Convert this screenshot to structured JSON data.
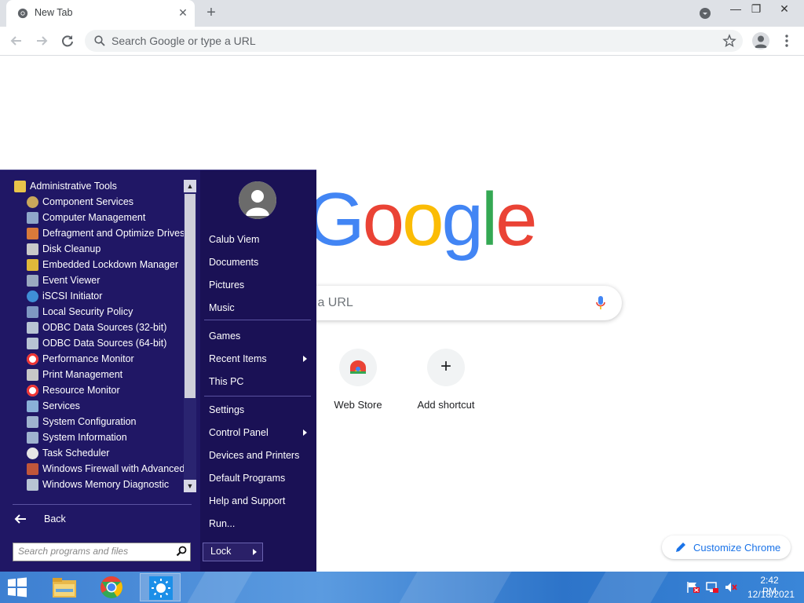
{
  "browser": {
    "tab_title": "New Tab",
    "new_tab_symbol": "+",
    "close_symbol": "✕",
    "omnibox_placeholder": "Search Google or type a URL",
    "window_min": "—",
    "window_restore": "❐",
    "window_close": "✕"
  },
  "ntp": {
    "logo_letters": [
      "G",
      "o",
      "o",
      "g",
      "l",
      "e"
    ],
    "logo_colors": [
      "#4285f4",
      "#ea4335",
      "#fbbc05",
      "#4285f4",
      "#34a853",
      "#ea4335"
    ],
    "search_placeholder": "Search Google or type a URL",
    "search_visible_text": "r type a URL",
    "shortcuts": [
      {
        "label": "Web Store",
        "icon": "chrome-web-store-icon"
      },
      {
        "label": "Add shortcut",
        "icon": "plus-icon",
        "symbol": "+"
      }
    ],
    "customize_label": "Customize Chrome"
  },
  "start_menu": {
    "programs": [
      {
        "label": "Administrative Tools",
        "icon": "folder-icon",
        "color": "#e8c44a",
        "indent": 0
      },
      {
        "label": "Component Services",
        "icon": "component-services-icon",
        "color": "#c9a75b",
        "indent": 1
      },
      {
        "label": "Computer Management",
        "icon": "computer-management-icon",
        "color": "#8fa7c9",
        "indent": 1
      },
      {
        "label": "Defragment and Optimize Drives",
        "icon": "defragment-icon",
        "color": "#d97a3a",
        "indent": 1
      },
      {
        "label": "Disk Cleanup",
        "icon": "disk-cleanup-icon",
        "color": "#c9c9c9",
        "indent": 1
      },
      {
        "label": "Embedded Lockdown Manager",
        "icon": "lock-icon",
        "color": "#e0b83a",
        "indent": 1
      },
      {
        "label": "Event Viewer",
        "icon": "event-viewer-icon",
        "color": "#9aa9c0",
        "indent": 1
      },
      {
        "label": "iSCSI Initiator",
        "icon": "globe-icon",
        "color": "#3f8fd6",
        "indent": 1
      },
      {
        "label": "Local Security Policy",
        "icon": "security-policy-icon",
        "color": "#7f98c2",
        "indent": 1
      },
      {
        "label": "ODBC Data Sources (32-bit)",
        "icon": "odbc-icon",
        "color": "#b8c4d4",
        "indent": 1
      },
      {
        "label": "ODBC Data Sources (64-bit)",
        "icon": "odbc-icon",
        "color": "#b8c4d4",
        "indent": 1
      },
      {
        "label": "Performance Monitor",
        "icon": "performance-monitor-icon",
        "color": "#ffffff",
        "indent": 1
      },
      {
        "label": "Print Management",
        "icon": "print-icon",
        "color": "#c8c8c8",
        "indent": 1
      },
      {
        "label": "Resource Monitor",
        "icon": "resource-monitor-icon",
        "color": "#ffffff",
        "indent": 1
      },
      {
        "label": "Services",
        "icon": "gear-icon",
        "color": "#8ab0d8",
        "indent": 1
      },
      {
        "label": "System Configuration",
        "icon": "system-configuration-icon",
        "color": "#9fb3cf",
        "indent": 1
      },
      {
        "label": "System Information",
        "icon": "system-information-icon",
        "color": "#9fb3cf",
        "indent": 1
      },
      {
        "label": "Task Scheduler",
        "icon": "clock-icon",
        "color": "#e6e6e6",
        "indent": 1
      },
      {
        "label": "Windows Firewall with Advanced",
        "icon": "firewall-icon",
        "color": "#c0563a",
        "indent": 1
      },
      {
        "label": "Windows Memory Diagnostic",
        "icon": "memory-diagnostic-icon",
        "color": "#b8c4d4",
        "indent": 1
      }
    ],
    "back_label": "Back",
    "search_placeholder": "Search programs and files",
    "user_name": "Calub Viem",
    "right_items": [
      {
        "label": "Calub Viem",
        "arrow": false,
        "group": 0
      },
      {
        "label": "Documents",
        "arrow": false,
        "group": 0
      },
      {
        "label": "Pictures",
        "arrow": false,
        "group": 0
      },
      {
        "label": "Music",
        "arrow": false,
        "group": 0
      },
      {
        "label": "Games",
        "arrow": false,
        "group": 1
      },
      {
        "label": "Recent Items",
        "arrow": true,
        "group": 1
      },
      {
        "label": "This PC",
        "arrow": false,
        "group": 1
      },
      {
        "label": "Settings",
        "arrow": false,
        "group": 2
      },
      {
        "label": "Control Panel",
        "arrow": true,
        "group": 2
      },
      {
        "label": "Devices and Printers",
        "arrow": false,
        "group": 2
      },
      {
        "label": "Default Programs",
        "arrow": false,
        "group": 2
      },
      {
        "label": "Help and Support",
        "arrow": false,
        "group": 2
      },
      {
        "label": "Run...",
        "arrow": false,
        "group": 2
      }
    ],
    "lock_label": "Lock"
  },
  "taskbar": {
    "items": [
      "file-explorer-icon",
      "chrome-icon",
      "start-menu-app-icon"
    ],
    "active_index": 2,
    "tray": [
      "action-center-flag-icon",
      "network-icon",
      "volume-muted-icon"
    ],
    "time": "2:42 PM",
    "date": "12/18/2021"
  }
}
